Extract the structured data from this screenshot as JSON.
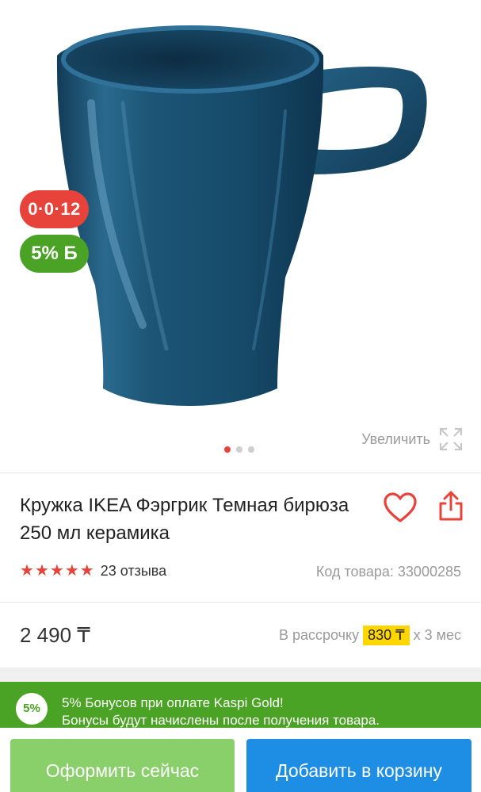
{
  "badges": {
    "installment": "0·0·12",
    "bonus": "5% Б"
  },
  "gallery": {
    "zoom_label": "Увеличить",
    "image_count": 3,
    "active_index": 0
  },
  "product": {
    "title": "Кружка IKEA Фэргрик Темная бирюза 250 мл керамика",
    "rating": 5,
    "reviews_text": "23 отзыва",
    "sku_text": "Код товара: 33000285"
  },
  "price": {
    "value": "2 490 ₸",
    "installment_prefix": "В рассрочку",
    "installment_amount": "830 ₸",
    "installment_suffix": "х 3 мес"
  },
  "bonus_banner": {
    "circle": "5%",
    "line1": "5% Бонусов при оплате Kaspi Gold!",
    "line2": "Бонусы будут начислены после получения товара."
  },
  "buttons": {
    "buy_now": "Оформить сейчас",
    "add_to_cart": "Добавить в корзину"
  },
  "colors": {
    "accent_red": "#e8433a",
    "bonus_green": "#4aa324",
    "buy_green": "#8ad06a",
    "cart_blue": "#1d8ee4",
    "installment_yellow": "#ffd600",
    "mug_blue": "#1b4f6e"
  }
}
